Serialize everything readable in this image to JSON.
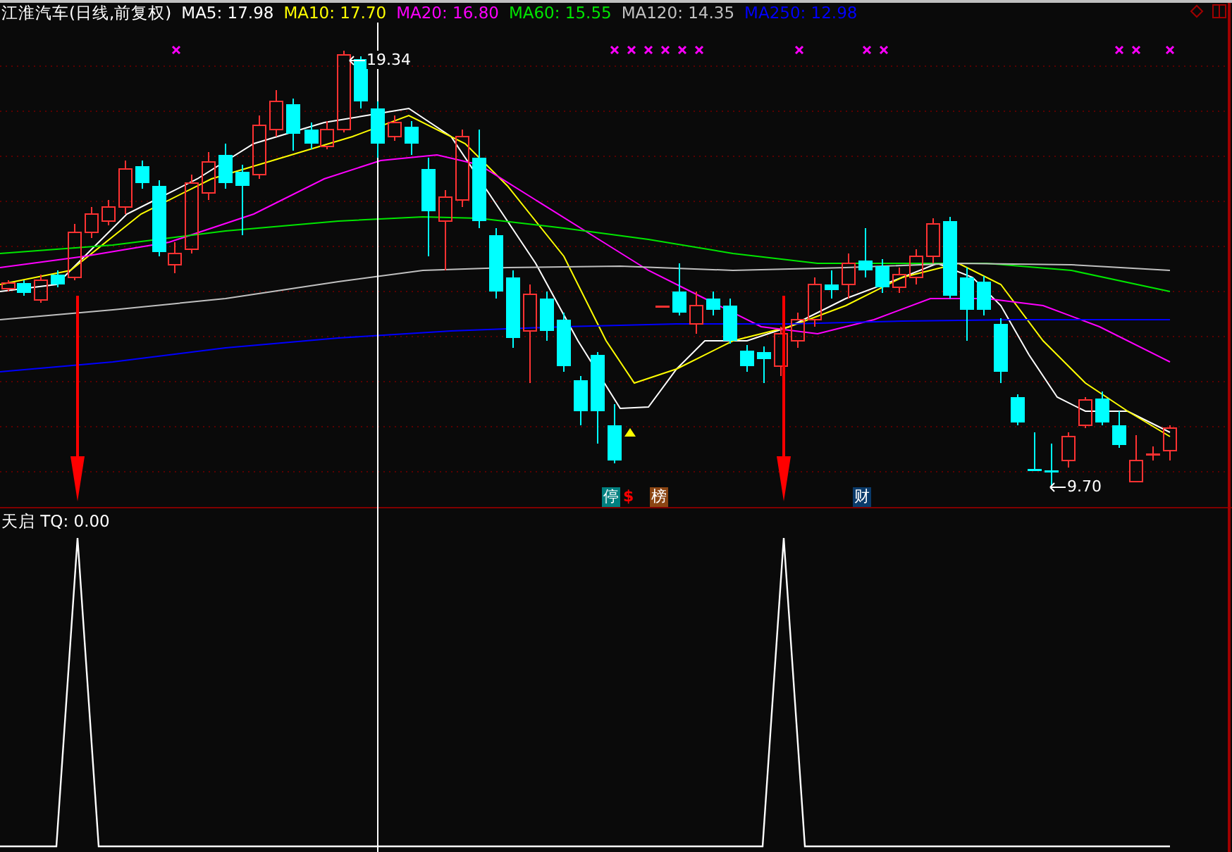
{
  "title": "江淮汽车(日线,前复权)",
  "moving_averages": [
    {
      "label": "MA5: 17.98",
      "color": "#ffffff"
    },
    {
      "label": "MA10: 17.70",
      "color": "#ffff00"
    },
    {
      "label": "MA20: 16.80",
      "color": "#ff00ff"
    },
    {
      "label": "MA60: 15.55",
      "color": "#00e600"
    },
    {
      "label": "MA120: 14.35",
      "color": "#c0c0c0"
    },
    {
      "label": "MA250: 12.98",
      "color": "#0000ff"
    }
  ],
  "price_labels": [
    {
      "text": "19.34",
      "kind": "high"
    },
    {
      "text": "9.70",
      "kind": "low"
    }
  ],
  "event_badges": [
    {
      "text": "停",
      "color": "#008080"
    },
    {
      "text": "$",
      "color": "#ff0000"
    },
    {
      "text": "榜",
      "color": "#8b4513"
    },
    {
      "text": "财",
      "color": "#0a3a6a"
    }
  ],
  "indicator": {
    "label": "天启 TQ: 0.00"
  }
}
